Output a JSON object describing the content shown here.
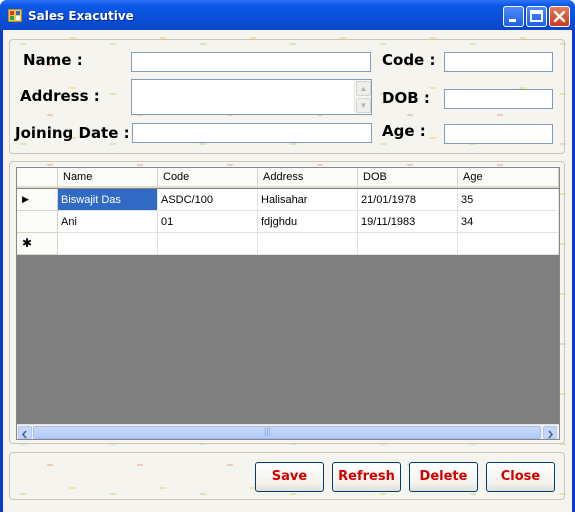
{
  "window": {
    "title": "Sales Exacutive",
    "colors": {
      "titlebar": "#0a4fd9",
      "accent_button_text": "#d40000",
      "selection": "#316ac5"
    }
  },
  "form": {
    "name_label": "Name :",
    "name_value": "",
    "code_label": "Code :",
    "code_value": "",
    "address_label": "Address :",
    "address_value": "",
    "dob_label": "DOB :",
    "dob_value": "",
    "joining_label": "Joining Date :",
    "joining_value": "",
    "age_label": "Age :",
    "age_value": ""
  },
  "grid": {
    "columns": [
      "Name",
      "Code",
      "Address",
      "DOB",
      "Age"
    ],
    "rows": [
      [
        "Biswajit Das",
        "ASDC/100",
        "Halisahar",
        "21/01/1978",
        "35"
      ],
      [
        "Ani",
        "01",
        "fdjghdu",
        "19/11/1983",
        "34"
      ]
    ],
    "current_row_marker": "▶",
    "new_row_marker": "✱",
    "scroll_grip": "|||"
  },
  "buttons": {
    "save": "Save",
    "refresh": "Refresh",
    "delete": "Delete",
    "close": "Close"
  }
}
